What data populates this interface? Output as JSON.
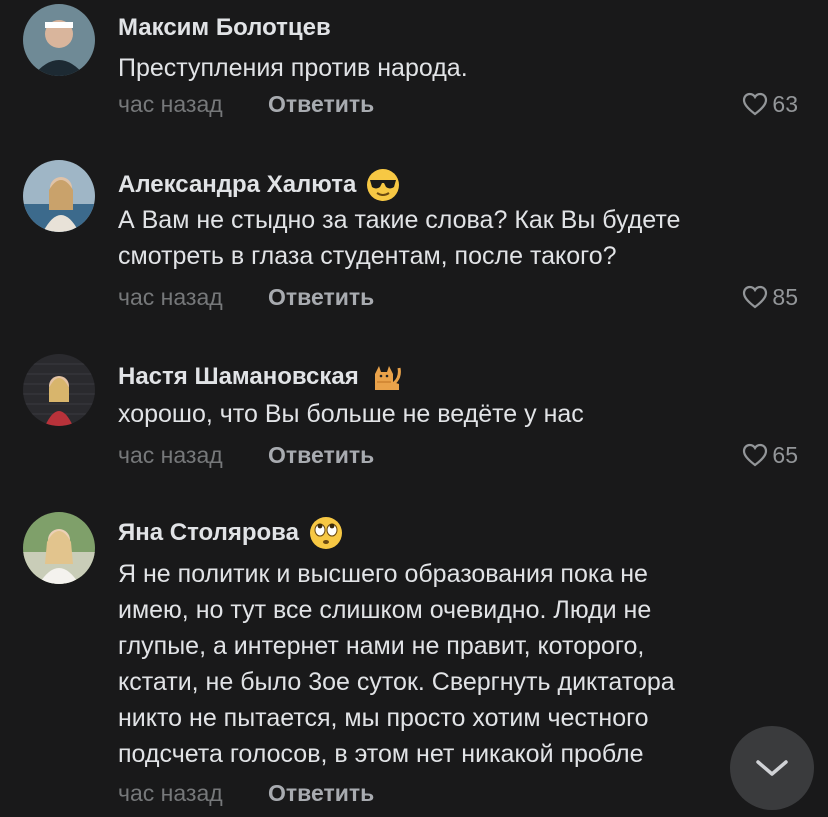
{
  "comments": [
    {
      "author": "Максим Болотцев",
      "lines": [
        "Преступления против народа."
      ],
      "time": "час назад",
      "reply_label": "Ответить",
      "likes": "63",
      "emoji": null
    },
    {
      "author": "Александра Халюта",
      "lines": [
        "А Вам не стыдно за такие слова? Как Вы будете",
        "смотреть в глаза студентам, после такого?"
      ],
      "time": "час назад",
      "reply_label": "Ответить",
      "likes": "85",
      "emoji": "sunglasses-face"
    },
    {
      "author": "Настя Шамановская",
      "lines": [
        "хорошо, что Вы больше не ведёте у нас"
      ],
      "time": "час назад",
      "reply_label": "Ответить",
      "likes": "65",
      "emoji": "cat"
    },
    {
      "author": "Яна Столярова",
      "lines": [
        "Я не политик и высшего образования пока не",
        "имею, но тут все слишком очевидно. Люди не",
        "глупые, а интернет нами не правит, которого,",
        "кстати, не было 3ое суток. Свергнуть диктатора",
        "никто не пытается, мы просто хотим честного",
        "подсчета голосов, в этом нет никакой пробле"
      ],
      "time": "час назад",
      "reply_label": "Ответить",
      "likes": "",
      "emoji": "eye-roll-face"
    }
  ],
  "colors": {
    "background": "#19191a",
    "author": "#e1e3e6",
    "time": "#76787a",
    "reply": "#a8abb0",
    "likes": "#939699"
  }
}
